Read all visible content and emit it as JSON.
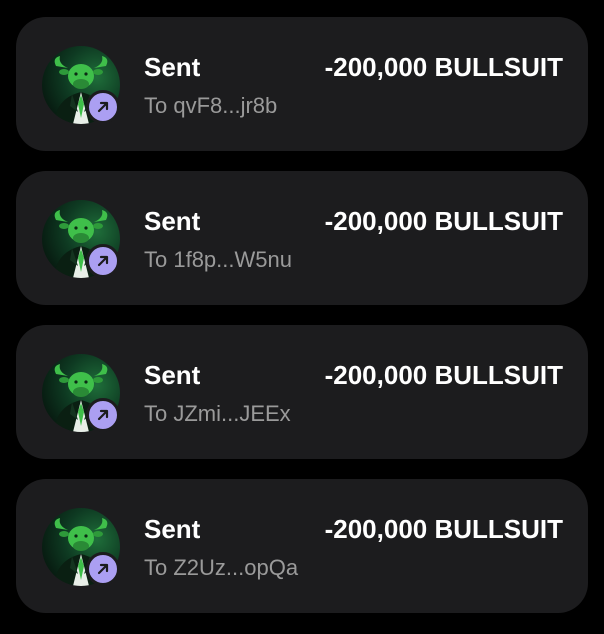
{
  "transactions": [
    {
      "title": "Sent",
      "amount": "-200,000 BULLSUIT",
      "recipient": "To qvF8...jr8b",
      "token_icon": "bull-in-suit-icon",
      "status_icon": "arrow-up-right-icon"
    },
    {
      "title": "Sent",
      "amount": "-200,000 BULLSUIT",
      "recipient": "To 1f8p...W5nu",
      "token_icon": "bull-in-suit-icon",
      "status_icon": "arrow-up-right-icon"
    },
    {
      "title": "Sent",
      "amount": "-200,000 BULLSUIT",
      "recipient": "To JZmi...JEEx",
      "token_icon": "bull-in-suit-icon",
      "status_icon": "arrow-up-right-icon"
    },
    {
      "title": "Sent",
      "amount": "-200,000 BULLSUIT",
      "recipient": "To Z2Uz...opQa",
      "token_icon": "bull-in-suit-icon",
      "status_icon": "arrow-up-right-icon"
    }
  ],
  "colors": {
    "background": "#000000",
    "card": "#1c1c1e",
    "primary_text": "#ffffff",
    "secondary_text": "#9a9a9a",
    "badge": "#ab9ff2",
    "bull_green": "#3fbf4a"
  }
}
